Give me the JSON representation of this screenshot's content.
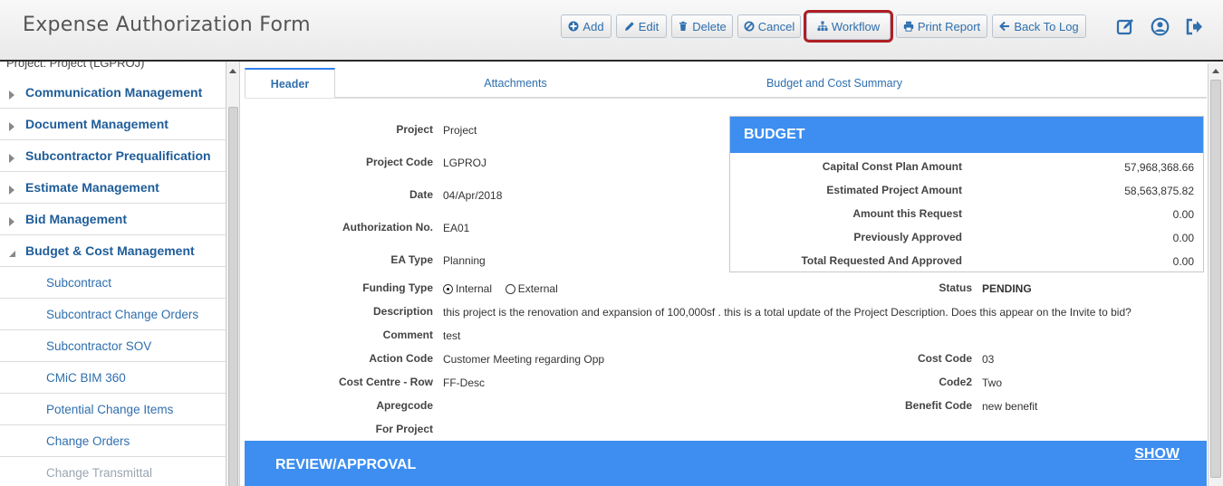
{
  "header": {
    "title": "Expense Authorization Form",
    "buttons": [
      {
        "label": "Add",
        "icon": "plus-circle-icon"
      },
      {
        "label": "Edit",
        "icon": "pencil-icon"
      },
      {
        "label": "Delete",
        "icon": "trash-icon"
      },
      {
        "label": "Cancel",
        "icon": "ban-icon"
      },
      {
        "label": "Workflow",
        "icon": "sitemap-icon",
        "highlighted": true
      },
      {
        "label": "Print Report",
        "icon": "printer-icon"
      },
      {
        "label": "Back To Log",
        "icon": "arrow-left-icon"
      }
    ],
    "right_icons": [
      "edit-square-icon",
      "user-circle-icon",
      "sign-out-icon"
    ],
    "accent": "#2f6fae",
    "highlight_color": "#b01e23"
  },
  "sidebar": {
    "cut_label": "Project: Project (LGPROJ)",
    "items": [
      {
        "label": "Communication Management",
        "type": "group",
        "open": false
      },
      {
        "label": "Document Management",
        "type": "group",
        "open": false
      },
      {
        "label": "Subcontractor Prequalification",
        "type": "group",
        "open": false
      },
      {
        "label": "Estimate Management",
        "type": "group",
        "open": false
      },
      {
        "label": "Bid Management",
        "type": "group",
        "open": false
      },
      {
        "label": "Budget & Cost Management",
        "type": "group",
        "open": true
      },
      {
        "label": "Subcontract",
        "type": "sub"
      },
      {
        "label": "Subcontract Change Orders",
        "type": "sub"
      },
      {
        "label": "Subcontractor SOV",
        "type": "sub"
      },
      {
        "label": "CMiC BIM 360",
        "type": "sub"
      },
      {
        "label": "Potential Change Items",
        "type": "sub"
      },
      {
        "label": "Change Orders",
        "type": "sub"
      },
      {
        "label": "Change Transmittal",
        "type": "sub",
        "dim": true
      }
    ]
  },
  "tabs": [
    {
      "label": "Header",
      "active": true
    },
    {
      "label": "Attachments",
      "active": false
    },
    {
      "label": "Budget and Cost Summary",
      "active": false
    }
  ],
  "form": {
    "project_label": "Project",
    "project_value": "Project",
    "project_code_label": "Project Code",
    "project_code_value": "LGPROJ",
    "date_label": "Date",
    "date_value": "04/Apr/2018",
    "auth_no_label": "Authorization No.",
    "auth_no_value": "EA01",
    "ea_type_label": "EA Type",
    "ea_type_value": "Planning",
    "funding_type_label": "Funding Type",
    "funding_internal": "Internal",
    "funding_external": "External",
    "funding_selected": "Internal",
    "description_label": "Description",
    "description_value": "this project is the renovation and expansion of 100,000sf . this is a total update of the Project Description. Does this appear on the Invite to bid?",
    "comment_label": "Comment",
    "comment_value": "test",
    "action_code_label": "Action Code",
    "action_code_value": "Customer Meeting regarding Opp",
    "cost_centre_label": "Cost Centre - Row",
    "cost_centre_value": "FF-Desc",
    "apregcode_label": "Apregcode",
    "for_project_label": "For Project",
    "status_label": "Status",
    "status_value": "PENDING",
    "cost_code_label": "Cost Code",
    "cost_code_value": "03",
    "code2_label": "Code2",
    "code2_value": "Two",
    "benefit_code_label": "Benefit Code",
    "benefit_code_value": "new benefit"
  },
  "budget": {
    "title": "BUDGET",
    "rows": [
      {
        "label": "Capital Const Plan Amount",
        "value": "57,968,368.66"
      },
      {
        "label": "Estimated Project Amount",
        "value": "58,563,875.82"
      },
      {
        "label": "Amount this Request",
        "value": "0.00"
      },
      {
        "label": "Previously Approved",
        "value": "0.00"
      },
      {
        "label": "Total Requested And Approved",
        "value": "0.00"
      }
    ],
    "color": "#3d8ef0"
  },
  "review": {
    "title": "REVIEW/APPROVAL",
    "show_label": "SHOW"
  }
}
